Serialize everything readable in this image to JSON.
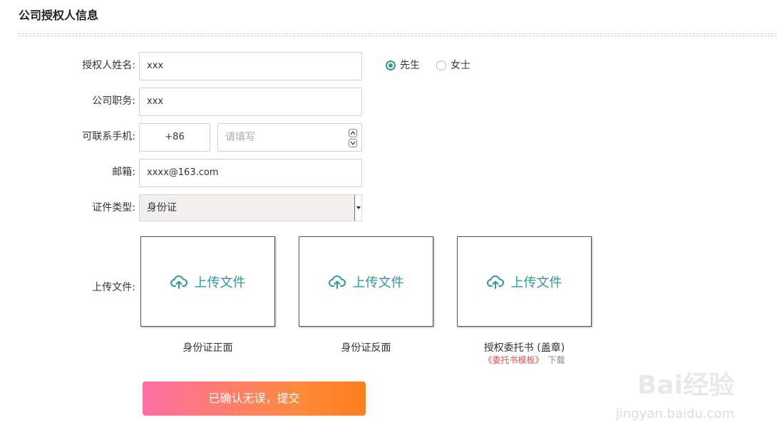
{
  "section": {
    "title": "公司授权人信息"
  },
  "fields": {
    "name_label": "授权人姓名:",
    "name_value": "xxx",
    "position_label": "公司职务:",
    "position_value": "xxx",
    "phone_label": "可联系手机:",
    "phone_code": "+86",
    "phone_placeholder": "请填写",
    "email_label": "邮箱:",
    "email_value": "xxxx@163.com",
    "id_type_label": "证件类型:",
    "id_type_value": "身份证",
    "upload_label": "上传文件:"
  },
  "gender": {
    "male": "先生",
    "female": "女士",
    "selected": "male"
  },
  "uploads": {
    "button_text": "上传文件",
    "items": [
      {
        "caption": "身份证正面"
      },
      {
        "caption": "身份证反面"
      },
      {
        "caption": "授权委托书 (盖章)"
      }
    ],
    "template_link": "《委托书模板》",
    "template_download": "下载"
  },
  "submit": {
    "label": "已确认无误，提交"
  },
  "watermark": {
    "text": "Bai经验",
    "sub": "jingyan.baidu.com"
  },
  "colors": {
    "accent": "#2a9d9a",
    "submit_start": "#fd6fa5",
    "submit_end": "#ff7e1d",
    "link": "#d9534f"
  }
}
